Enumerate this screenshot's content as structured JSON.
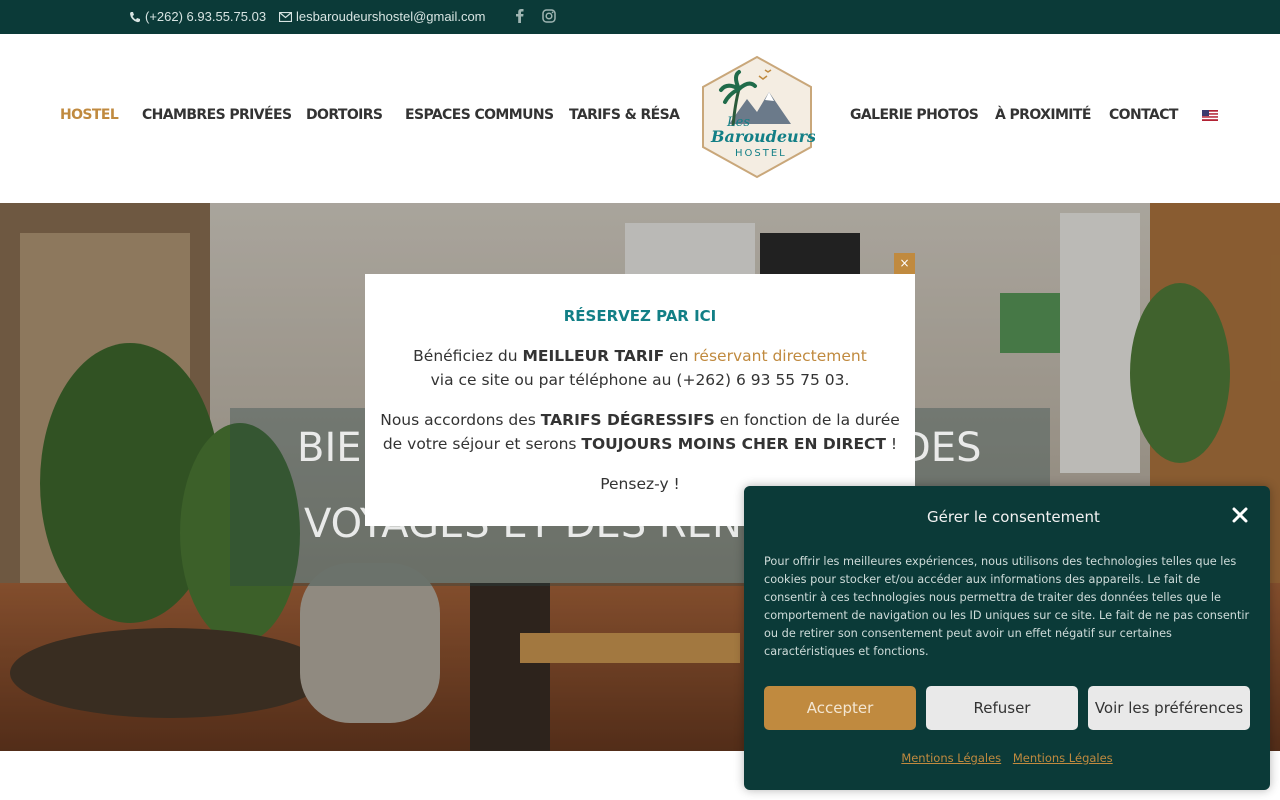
{
  "topbar": {
    "phone": "(+262) 6.93.55.75.03",
    "email": "lesbaroudeurshostel@gmail.com",
    "social": [
      "facebook-icon",
      "instagram-icon"
    ]
  },
  "nav": {
    "left": [
      "HOSTEL",
      "CHAMBRES PRIVÉES",
      "DORTOIRS",
      "ESPACES COMMUNS",
      "TARIFS & RÉSA"
    ],
    "right": [
      "GALERIE PHOTOS",
      "À PROXIMITÉ",
      "CONTACT"
    ],
    "active": "HOSTEL"
  },
  "logo": {
    "line1": "Les",
    "line2": "Baroudeurs",
    "line3": "HOSTEL"
  },
  "hero": {
    "line1": "BIE",
    "line1b": "DES",
    "line2": "VOYAGES ET DES REN"
  },
  "popup": {
    "title": "RÉSERVEZ PAR ICI",
    "p1a": "Bénéficiez du ",
    "p1b": "MEILLEUR TARIF",
    "p1c": " en ",
    "p1d": "réservant directement",
    "p1e": "via ce site ou par téléphone au (+262) 6 93 55 75 03.",
    "p2a": "Nous accordons des ",
    "p2b": "TARIFS DÉGRESSIFS",
    "p2c": " en fonction de la durée",
    "p2d": "de votre séjour et serons ",
    "p2e": "TOUJOURS MOINS CHER EN DIRECT",
    "p2f": " !",
    "p3": "Pensez-y !",
    "close": "×"
  },
  "consent": {
    "title": "Gérer le consentement",
    "text": "Pour offrir les meilleures expériences, nous utilisons des technologies telles que les cookies pour stocker et/ou accéder aux informations des appareils. Le fait de consentir à ces technologies nous permettra de traiter des données telles que le comportement de navigation ou les ID uniques sur ce site. Le fait de ne pas consentir ou de retirer son consentement peut avoir un effet négatif sur certaines caractéristiques et fonctions.",
    "accept": "Accepter",
    "refuse": "Refuser",
    "prefs": "Voir les préférences",
    "links": [
      "Mentions Légales",
      "Mentions Légales"
    ]
  },
  "colors": {
    "dark_teal": "#0b3a38",
    "accent": "#c08a3f",
    "title_teal": "#127f86"
  }
}
